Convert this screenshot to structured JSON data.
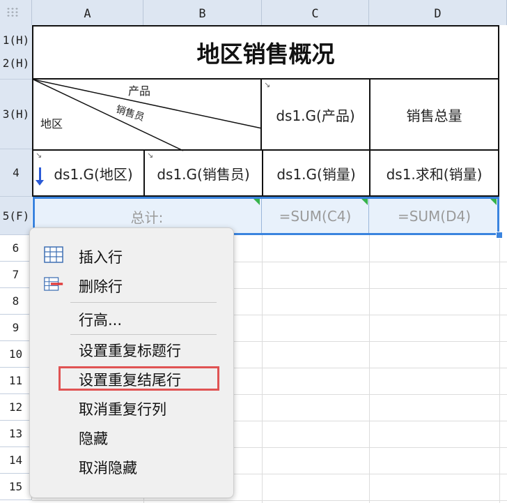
{
  "columns": [
    "A",
    "B",
    "C",
    "D"
  ],
  "rows": {
    "r1": "1(H)",
    "r2": "2(H)",
    "r3": "3(H)",
    "r4": "4",
    "r5": "5(F)",
    "r6": "6",
    "r7": "7",
    "r8": "8",
    "r9": "9",
    "r10": "10",
    "r11": "11",
    "r12": "12",
    "r13": "13",
    "r14": "14",
    "r15": "15"
  },
  "report": {
    "title": "地区销售概况",
    "diag_product": "产品",
    "diag_salesperson": "销售员",
    "diag_region": "地区",
    "c3": "ds1.G(产品)",
    "d3": "销售总量",
    "a4": "ds1.G(地区)",
    "b4": "ds1.G(销售员)",
    "c4": "ds1.G(销量)",
    "d4": "ds1.求和(销量)",
    "a5": "总计:",
    "c5": "=SUM(C4)",
    "d5": "=SUM(D4)"
  },
  "menu": {
    "insert_row": "插入行",
    "delete_row": "删除行",
    "row_height": "行高...",
    "set_repeat_header": "设置重复标题行",
    "set_repeat_footer": "设置重复结尾行",
    "cancel_repeat": "取消重复行列",
    "hide": "隐藏",
    "unhide": "取消隐藏"
  },
  "colors": {
    "selection": "#3a84df",
    "highlight": "#e05353",
    "header_bg": "#dde6f2",
    "accent_green": "#36b34b"
  }
}
